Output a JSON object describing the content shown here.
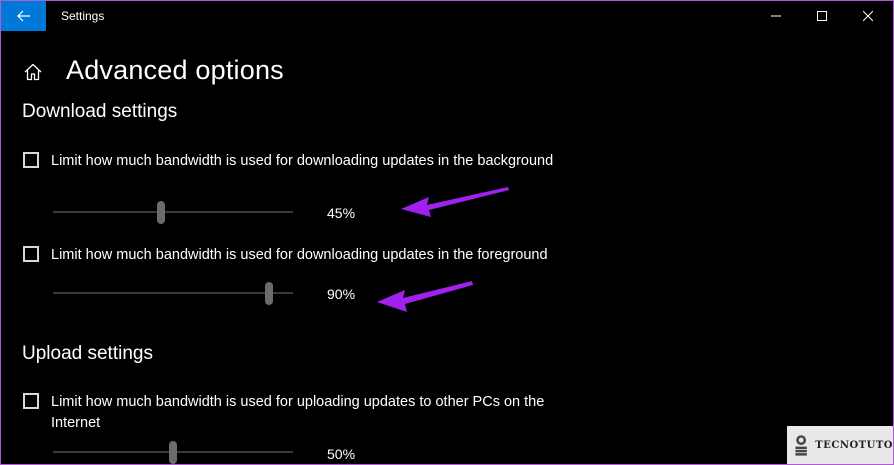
{
  "window": {
    "title": "Settings",
    "colors": {
      "accent": "#0078d7",
      "annotation": "#a020f0",
      "background": "#000000"
    }
  },
  "header": {
    "title": "Advanced options",
    "home_icon": "home-icon",
    "back_icon": "arrow-left-icon"
  },
  "download": {
    "section_title": "Download settings",
    "background": {
      "label": "Limit how much bandwidth is used for downloading updates in the background",
      "checked": false,
      "slider_percent": 45,
      "value_text": "45%"
    },
    "foreground": {
      "label": "Limit how much bandwidth is used for downloading updates in the foreground",
      "checked": false,
      "slider_percent": 90,
      "value_text": "90%"
    }
  },
  "upload": {
    "section_title": "Upload settings",
    "limit": {
      "label": "Limit how much bandwidth is used for uploading updates to other PCs on the Internet",
      "checked": false,
      "slider_percent": 50,
      "value_text": "50%"
    }
  },
  "watermark": {
    "text": "TECNOTUTO"
  }
}
